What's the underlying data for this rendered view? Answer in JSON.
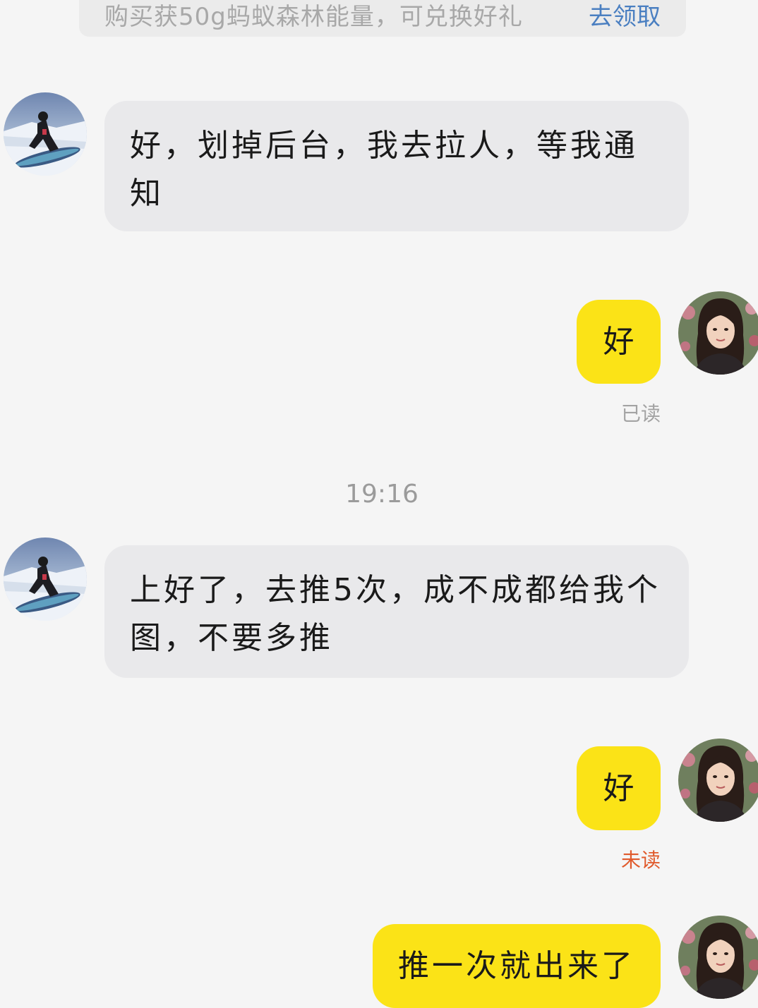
{
  "promo": {
    "text": "购买获50g蚂蚁森林能量，可兑换好礼",
    "link": "去领取",
    "link_color": "#4a7fc1"
  },
  "messages": [
    {
      "side": "left",
      "avatar": "snowboarder-avatar",
      "text": "好，划掉后台，我去拉人，等我通知"
    },
    {
      "side": "right",
      "avatar": "woman-avatar",
      "text": "好",
      "status": "已读"
    },
    {
      "side": "left",
      "avatar": "snowboarder-avatar",
      "text": "上好了，去推5次，成不成都给我个图，不要多推"
    },
    {
      "side": "right",
      "avatar": "woman-avatar",
      "text": "好",
      "status": "未读"
    },
    {
      "side": "right",
      "avatar": "woman-avatar",
      "text": "推一次就出来了"
    }
  ],
  "timestamp": "19:16",
  "colors": {
    "background": "#f5f5f5",
    "bubble_left": "#e9e9eb",
    "bubble_right": "#fbe317",
    "read_status": "#a3a3a3",
    "unread_status": "#e05a2c"
  }
}
